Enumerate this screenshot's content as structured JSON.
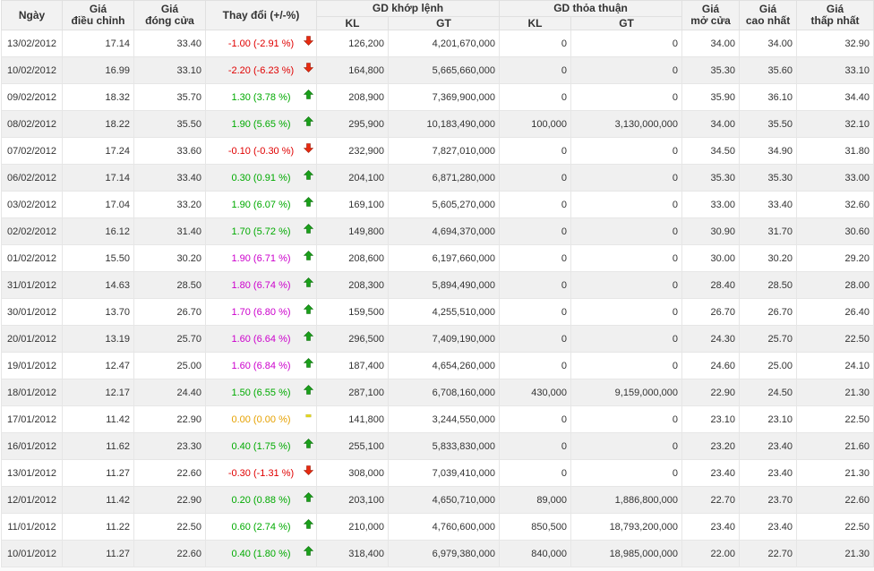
{
  "colors": {
    "up": "#00aa00",
    "down": "#e00000",
    "ceiling": "#cc00cc",
    "ref": "#e6a100",
    "header_bg": "#f2f2f2",
    "alt_row": "#f0f0f0"
  },
  "headers": {
    "date": "Ngày",
    "adjusted": [
      "Giá",
      "điều chỉnh"
    ],
    "close": [
      "Giá",
      "đóng cửa"
    ],
    "change": "Thay đổi (+/-%)",
    "matched": "GD khớp lệnh",
    "negotiated": "GD thỏa thuận",
    "kl": "KL",
    "gt": "GT",
    "open": [
      "Giá",
      "mở cửa"
    ],
    "high": [
      "Giá",
      "cao nhất"
    ],
    "low": [
      "Giá",
      "thấp nhất"
    ]
  },
  "rows": [
    {
      "date": "13/02/2012",
      "adj": "17.14",
      "close": "33.40",
      "change": "-1.00 (-2.91 %)",
      "dir": "down",
      "m_kl": "126,200",
      "m_gt": "4,201,670,000",
      "n_kl": "0",
      "n_gt": "0",
      "open": "34.00",
      "high": "34.00",
      "low": "32.90"
    },
    {
      "date": "10/02/2012",
      "adj": "16.99",
      "close": "33.10",
      "change": "-2.20 (-6.23 %)",
      "dir": "down",
      "m_kl": "164,800",
      "m_gt": "5,665,660,000",
      "n_kl": "0",
      "n_gt": "0",
      "open": "35.30",
      "high": "35.60",
      "low": "33.10"
    },
    {
      "date": "09/02/2012",
      "adj": "18.32",
      "close": "35.70",
      "change": "1.30 (3.78 %)",
      "dir": "up",
      "m_kl": "208,900",
      "m_gt": "7,369,900,000",
      "n_kl": "0",
      "n_gt": "0",
      "open": "35.90",
      "high": "36.10",
      "low": "34.40"
    },
    {
      "date": "08/02/2012",
      "adj": "18.22",
      "close": "35.50",
      "change": "1.90 (5.65 %)",
      "dir": "up",
      "m_kl": "295,900",
      "m_gt": "10,183,490,000",
      "n_kl": "100,000",
      "n_gt": "3,130,000,000",
      "open": "34.00",
      "high": "35.50",
      "low": "32.10"
    },
    {
      "date": "07/02/2012",
      "adj": "17.24",
      "close": "33.60",
      "change": "-0.10 (-0.30 %)",
      "dir": "down",
      "m_kl": "232,900",
      "m_gt": "7,827,010,000",
      "n_kl": "0",
      "n_gt": "0",
      "open": "34.50",
      "high": "34.90",
      "low": "31.80"
    },
    {
      "date": "06/02/2012",
      "adj": "17.14",
      "close": "33.40",
      "change": "0.30 (0.91 %)",
      "dir": "up",
      "m_kl": "204,100",
      "m_gt": "6,871,280,000",
      "n_kl": "0",
      "n_gt": "0",
      "open": "35.30",
      "high": "35.30",
      "low": "33.00"
    },
    {
      "date": "03/02/2012",
      "adj": "17.04",
      "close": "33.20",
      "change": "1.90 (6.07 %)",
      "dir": "up",
      "m_kl": "169,100",
      "m_gt": "5,605,270,000",
      "n_kl": "0",
      "n_gt": "0",
      "open": "33.00",
      "high": "33.40",
      "low": "32.60"
    },
    {
      "date": "02/02/2012",
      "adj": "16.12",
      "close": "31.40",
      "change": "1.70 (5.72 %)",
      "dir": "up",
      "m_kl": "149,800",
      "m_gt": "4,694,370,000",
      "n_kl": "0",
      "n_gt": "0",
      "open": "30.90",
      "high": "31.70",
      "low": "30.60"
    },
    {
      "date": "01/02/2012",
      "adj": "15.50",
      "close": "30.20",
      "change": "1.90 (6.71 %)",
      "dir": "ceiling",
      "m_kl": "208,600",
      "m_gt": "6,197,660,000",
      "n_kl": "0",
      "n_gt": "0",
      "open": "30.00",
      "high": "30.20",
      "low": "29.20"
    },
    {
      "date": "31/01/2012",
      "adj": "14.63",
      "close": "28.50",
      "change": "1.80 (6.74 %)",
      "dir": "ceiling",
      "m_kl": "208,300",
      "m_gt": "5,894,490,000",
      "n_kl": "0",
      "n_gt": "0",
      "open": "28.40",
      "high": "28.50",
      "low": "28.00"
    },
    {
      "date": "30/01/2012",
      "adj": "13.70",
      "close": "26.70",
      "change": "1.70 (6.80 %)",
      "dir": "ceiling",
      "m_kl": "159,500",
      "m_gt": "4,255,510,000",
      "n_kl": "0",
      "n_gt": "0",
      "open": "26.70",
      "high": "26.70",
      "low": "26.40"
    },
    {
      "date": "20/01/2012",
      "adj": "13.19",
      "close": "25.70",
      "change": "1.60 (6.64 %)",
      "dir": "ceiling",
      "m_kl": "296,500",
      "m_gt": "7,409,190,000",
      "n_kl": "0",
      "n_gt": "0",
      "open": "24.30",
      "high": "25.70",
      "low": "22.50"
    },
    {
      "date": "19/01/2012",
      "adj": "12.47",
      "close": "25.00",
      "change": "1.60 (6.84 %)",
      "dir": "ceiling",
      "m_kl": "187,400",
      "m_gt": "4,654,260,000",
      "n_kl": "0",
      "n_gt": "0",
      "open": "24.60",
      "high": "25.00",
      "low": "24.10"
    },
    {
      "date": "18/01/2012",
      "adj": "12.17",
      "close": "24.40",
      "change": "1.50 (6.55 %)",
      "dir": "up",
      "m_kl": "287,100",
      "m_gt": "6,708,160,000",
      "n_kl": "430,000",
      "n_gt": "9,159,000,000",
      "open": "22.90",
      "high": "24.50",
      "low": "21.30"
    },
    {
      "date": "17/01/2012",
      "adj": "11.42",
      "close": "22.90",
      "change": "0.00 (0.00 %)",
      "dir": "ref",
      "m_kl": "141,800",
      "m_gt": "3,244,550,000",
      "n_kl": "0",
      "n_gt": "0",
      "open": "23.10",
      "high": "23.10",
      "low": "22.50"
    },
    {
      "date": "16/01/2012",
      "adj": "11.62",
      "close": "23.30",
      "change": "0.40 (1.75 %)",
      "dir": "up",
      "m_kl": "255,100",
      "m_gt": "5,833,830,000",
      "n_kl": "0",
      "n_gt": "0",
      "open": "23.20",
      "high": "23.40",
      "low": "21.60"
    },
    {
      "date": "13/01/2012",
      "adj": "11.27",
      "close": "22.60",
      "change": "-0.30 (-1.31 %)",
      "dir": "down",
      "m_kl": "308,000",
      "m_gt": "7,039,410,000",
      "n_kl": "0",
      "n_gt": "0",
      "open": "23.40",
      "high": "23.40",
      "low": "21.30"
    },
    {
      "date": "12/01/2012",
      "adj": "11.42",
      "close": "22.90",
      "change": "0.20 (0.88 %)",
      "dir": "up",
      "m_kl": "203,100",
      "m_gt": "4,650,710,000",
      "n_kl": "89,000",
      "n_gt": "1,886,800,000",
      "open": "22.70",
      "high": "23.70",
      "low": "22.60"
    },
    {
      "date": "11/01/2012",
      "adj": "11.22",
      "close": "22.50",
      "change": "0.60 (2.74 %)",
      "dir": "up",
      "m_kl": "210,000",
      "m_gt": "4,760,600,000",
      "n_kl": "850,500",
      "n_gt": "18,793,200,000",
      "open": "23.40",
      "high": "23.40",
      "low": "22.50"
    },
    {
      "date": "10/01/2012",
      "adj": "11.27",
      "close": "22.60",
      "change": "0.40 (1.80 %)",
      "dir": "up",
      "m_kl": "318,400",
      "m_gt": "6,979,380,000",
      "n_kl": "840,000",
      "n_gt": "18,985,000,000",
      "open": "22.00",
      "high": "22.70",
      "low": "21.30"
    }
  ]
}
